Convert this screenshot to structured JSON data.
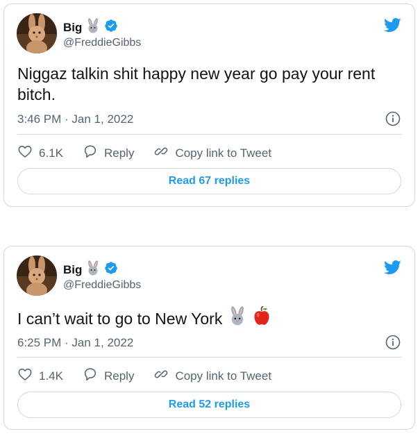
{
  "tweets": [
    {
      "author": {
        "name": "Big",
        "handle": "@FreddieGibbs",
        "name_emoji": "rabbit-face-icon",
        "verified": true
      },
      "text": "Niggaz talkin shit happy new year go pay your rent bitch.",
      "timestamp": "3:46 PM · Jan 1, 2022",
      "likes": "6.1K",
      "reply_label": "Reply",
      "copy_link_label": "Copy link to Tweet",
      "read_replies_label": "Read 67 replies"
    },
    {
      "author": {
        "name": "Big",
        "handle": "@FreddieGibbs",
        "name_emoji": "rabbit-face-icon",
        "verified": true
      },
      "text": "I can’t wait to go to New York",
      "text_emojis": [
        "rabbit-face-icon",
        "red-apple-icon"
      ],
      "timestamp": "6:25 PM · Jan 1, 2022",
      "likes": "1.4K",
      "reply_label": "Reply",
      "copy_link_label": "Copy link to Tweet",
      "read_replies_label": "Read 52 replies"
    }
  ],
  "colors": {
    "twitter_blue": "#1d9bf0",
    "text_primary": "#0f1419",
    "text_secondary": "#536471",
    "border": "#cfd9de"
  }
}
